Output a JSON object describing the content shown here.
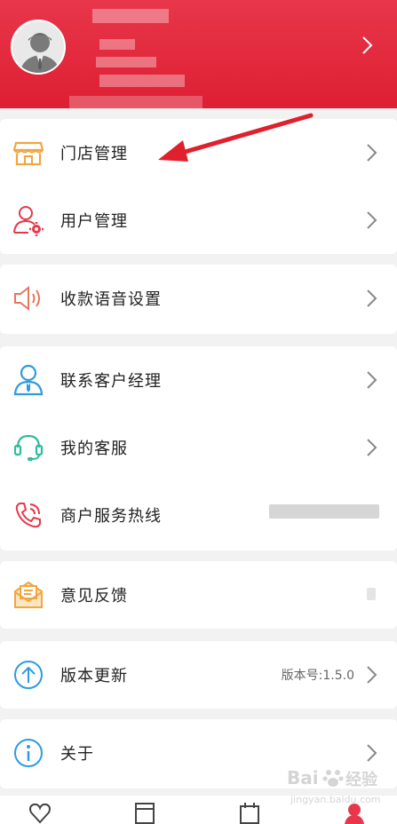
{
  "profile": {
    "avatar": "user-avatar"
  },
  "menu": {
    "store_management": "门店管理",
    "user_management": "用户管理",
    "payment_voice": "收款语音设置",
    "contact_manager": "联系客户经理",
    "my_service": "我的客服",
    "merchant_hotline": "商户服务热线",
    "feedback": "意见反馈",
    "version_update": "版本更新",
    "version_label": "版本号:1.5.0",
    "about": "关于"
  },
  "watermark": {
    "brand": "Bai",
    "sub": "jingyan.baidu.com",
    "cn": "经验"
  },
  "colors": {
    "header_red": "#e01f34",
    "annotation_arrow": "#e0202c"
  }
}
